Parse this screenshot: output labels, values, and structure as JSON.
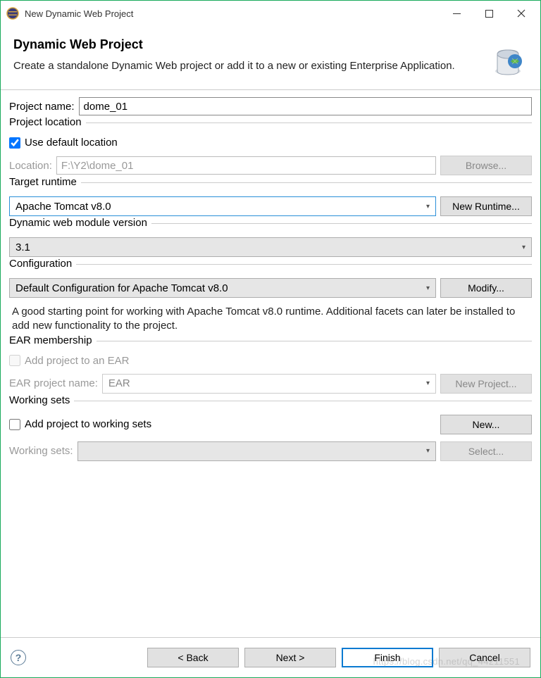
{
  "window": {
    "title": "New Dynamic Web Project"
  },
  "header": {
    "title": "Dynamic Web Project",
    "desc": "Create a standalone Dynamic Web project or add it to a new or existing Enterprise Application."
  },
  "projectName": {
    "label": "Project name:",
    "value": "dome_01"
  },
  "projectLocation": {
    "groupTitle": "Project location",
    "useDefaultLabel": "Use default location",
    "useDefault": true,
    "locationLabel": "Location:",
    "locationValue": "F:\\Y2\\dome_01",
    "browseLabel": "Browse..."
  },
  "targetRuntime": {
    "groupTitle": "Target runtime",
    "selected": "Apache Tomcat v8.0",
    "newRuntimeLabel": "New Runtime..."
  },
  "moduleVersion": {
    "groupTitle": "Dynamic web module version",
    "selected": "3.1"
  },
  "configuration": {
    "groupTitle": "Configuration",
    "selected": "Default Configuration for Apache Tomcat v8.0",
    "modifyLabel": "Modify...",
    "helpText": "A good starting point for working with Apache Tomcat v8.0 runtime. Additional facets can later be installed to add new functionality to the project."
  },
  "ear": {
    "groupTitle": "EAR membership",
    "addToEarLabel": "Add project to an EAR",
    "earProjectNameLabel": "EAR project name:",
    "earProjectNameValue": "EAR",
    "newProjectLabel": "New Project..."
  },
  "workingSets": {
    "groupTitle": "Working sets",
    "addLabel": "Add project to working sets",
    "newLabel": "New...",
    "wsLabel": "Working sets:",
    "selectLabel": "Select..."
  },
  "footer": {
    "back": "< Back",
    "next": "Next >",
    "finish": "Finish",
    "cancel": "Cancel"
  },
  "watermark": "https://blog.csdn.net/qq_44211551"
}
